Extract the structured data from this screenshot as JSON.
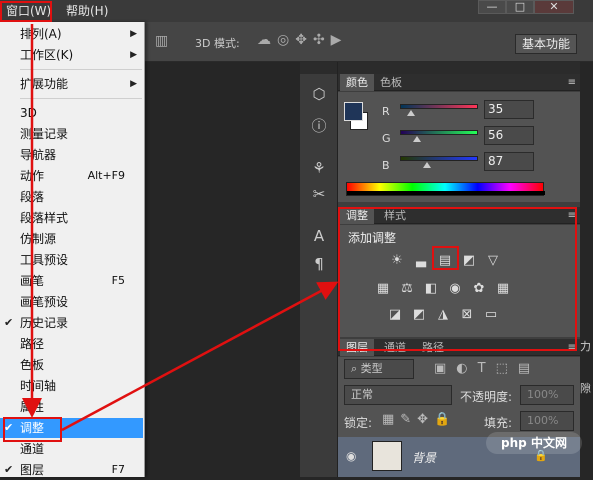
{
  "menubar": {
    "window_label": "窗口(W)",
    "help_label": "帮助(H)",
    "minimize": "—",
    "restore": "□",
    "close": "✕"
  },
  "options": {
    "mode_label": "3D 模式:",
    "workspace_button": "基本功能"
  },
  "window_menu": {
    "items": [
      {
        "label": "排列(A)",
        "shortcut": "",
        "submenu": true,
        "checked": false
      },
      {
        "label": "工作区(K)",
        "shortcut": "",
        "submenu": true,
        "checked": false
      },
      {
        "label": "扩展功能",
        "shortcut": "",
        "submenu": true,
        "checked": false
      },
      {
        "label": "3D",
        "shortcut": "",
        "submenu": false,
        "checked": false
      },
      {
        "label": "测量记录",
        "shortcut": "",
        "submenu": false,
        "checked": false
      },
      {
        "label": "导航器",
        "shortcut": "",
        "submenu": false,
        "checked": false
      },
      {
        "label": "动作",
        "shortcut": "Alt+F9",
        "submenu": false,
        "checked": false
      },
      {
        "label": "段落",
        "shortcut": "",
        "submenu": false,
        "checked": false
      },
      {
        "label": "段落样式",
        "shortcut": "",
        "submenu": false,
        "checked": false
      },
      {
        "label": "仿制源",
        "shortcut": "",
        "submenu": false,
        "checked": false
      },
      {
        "label": "工具预设",
        "shortcut": "",
        "submenu": false,
        "checked": false
      },
      {
        "label": "画笔",
        "shortcut": "F5",
        "submenu": false,
        "checked": false
      },
      {
        "label": "画笔预设",
        "shortcut": "",
        "submenu": false,
        "checked": false
      },
      {
        "label": "历史记录",
        "shortcut": "",
        "submenu": false,
        "checked": true
      },
      {
        "label": "路径",
        "shortcut": "",
        "submenu": false,
        "checked": false
      },
      {
        "label": "色板",
        "shortcut": "",
        "submenu": false,
        "checked": false
      },
      {
        "label": "时间轴",
        "shortcut": "",
        "submenu": false,
        "checked": false
      },
      {
        "label": "属性",
        "shortcut": "",
        "submenu": false,
        "checked": false
      },
      {
        "label": "调整",
        "shortcut": "",
        "submenu": false,
        "checked": true,
        "selected": true
      },
      {
        "label": "通道",
        "shortcut": "",
        "submenu": false,
        "checked": false
      },
      {
        "label": "图层",
        "shortcut": "F7",
        "submenu": false,
        "checked": true
      }
    ]
  },
  "color_panel": {
    "tabs": [
      "颜色",
      "色板"
    ],
    "swatch_color": "#1f3558",
    "channels": [
      {
        "name": "R",
        "value": "35",
        "fraction": 0.14
      },
      {
        "name": "G",
        "value": "56",
        "fraction": 0.22
      },
      {
        "name": "B",
        "value": "87",
        "fraction": 0.34
      }
    ]
  },
  "adjust_panel": {
    "tabs": [
      "调整",
      "样式"
    ],
    "title": "添加调整"
  },
  "layers_panel": {
    "tabs": [
      "图层",
      "通道",
      "路径"
    ],
    "filter_label": "类型",
    "blend_mode": "正常",
    "opacity_label": "不透明度:",
    "opacity_value": "100%",
    "lock_label": "锁定:",
    "fill_label": "填充:",
    "fill_value": "100%",
    "layer_name": "背景"
  },
  "watermark": "php 中文网",
  "edge_glyphs": [
    "力",
    "隙"
  ],
  "accent_red": "#e01010"
}
